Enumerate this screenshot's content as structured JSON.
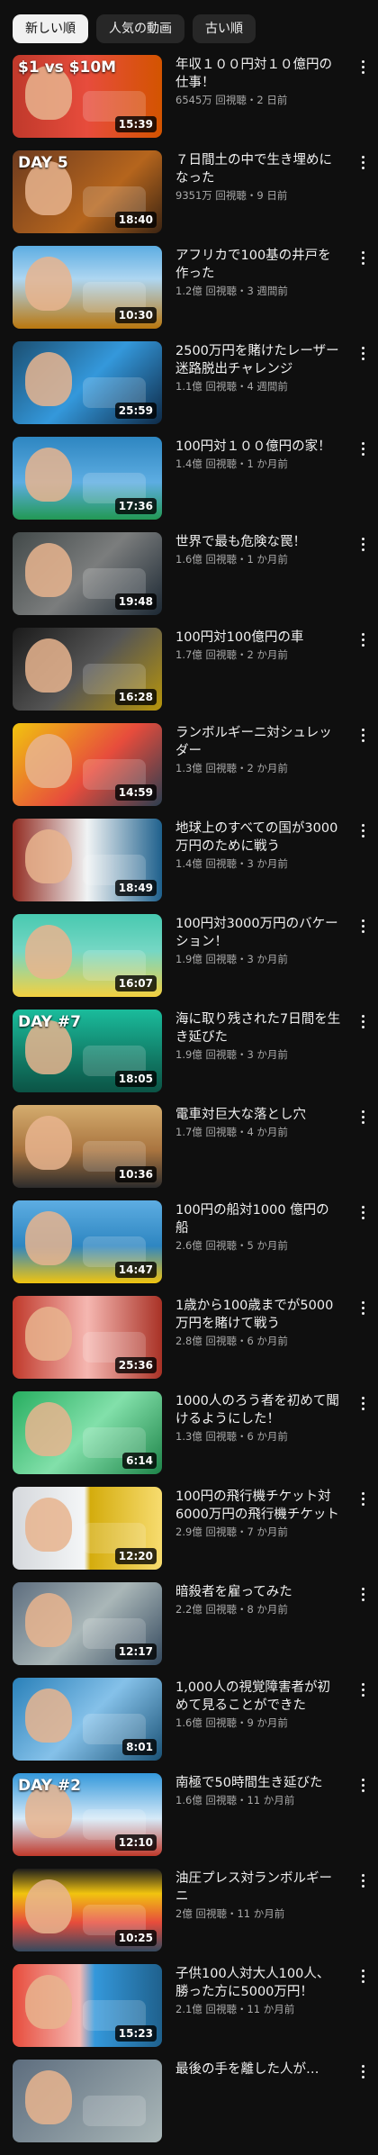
{
  "filters": [
    {
      "label": "新しい順",
      "active": true
    },
    {
      "label": "人気の動画",
      "active": false
    },
    {
      "label": "古い順",
      "active": false
    }
  ],
  "videos": [
    {
      "title": "年収１００円対１０億円の仕事！",
      "views": "6545万 回視聴",
      "age": "2 日前",
      "duration": "15:39",
      "overlay": "$1 vs $10M",
      "bg": "linear-gradient(90deg,#c0392b,#e74c3c 50%,#d35400)"
    },
    {
      "title": "７日間土の中で生き埋めになった",
      "views": "9351万 回視聴",
      "age": "9 日前",
      "duration": "18:40",
      "overlay": "DAY 5",
      "bg": "linear-gradient(135deg,#6e3b1f,#b5651d 60%,#3b2412)"
    },
    {
      "title": "アフリカで100基の井戸を作った",
      "views": "1.2億 回視聴",
      "age": "3 週間前",
      "duration": "10:30",
      "overlay": "",
      "bg": "linear-gradient(180deg,#5dade2,#aed6f1 40%,#b9770e)"
    },
    {
      "title": "2500万円を賭けたレーザー迷路脱出チャレンジ",
      "views": "1.1億 回視聴",
      "age": "4 週間前",
      "duration": "25:59",
      "overlay": "",
      "bg": "linear-gradient(135deg,#1b4f72,#3498db 50%,#0e2a47)"
    },
    {
      "title": "100円対１００億円の家！",
      "views": "1.4億 回視聴",
      "age": "1 か月前",
      "duration": "17:36",
      "overlay": "",
      "bg": "linear-gradient(180deg,#2e86c1,#5dade2 55%,#229954)"
    },
    {
      "title": "世界で最も危険な罠！",
      "views": "1.6億 回視聴",
      "age": "1 か月前",
      "duration": "19:48",
      "overlay": "",
      "bg": "linear-gradient(135deg,#424949,#7b7d7d 50%,#1c2833)"
    },
    {
      "title": "100円対100億円の車",
      "views": "1.7億 回視聴",
      "age": "2 か月前",
      "duration": "16:28",
      "overlay": "",
      "bg": "linear-gradient(135deg,#1a1a1a,#555 50%,#b7950b)"
    },
    {
      "title": "ランボルギーニ対シュレッダー",
      "views": "1.3億 回視聴",
      "age": "2 か月前",
      "duration": "14:59",
      "overlay": "",
      "bg": "linear-gradient(135deg,#f1c40f,#e74c3c 55%,#2c3e50)"
    },
    {
      "title": "地球上のすべての国が3000万円のために戦う",
      "views": "1.4億 回視聴",
      "age": "3 か月前",
      "duration": "18:49",
      "overlay": "",
      "bg": "linear-gradient(90deg,#922b21,#f0f3f4 50%,#1f618d)"
    },
    {
      "title": "100円対3000万円のバケーション！",
      "views": "1.9億 回視聴",
      "age": "3 か月前",
      "duration": "16:07",
      "overlay": "",
      "bg": "linear-gradient(180deg,#48c9b0,#76d7c4 45%,#f4d03f)"
    },
    {
      "title": "海に取り残された7日間を生き延びた",
      "views": "1.9億 回視聴",
      "age": "3 か月前",
      "duration": "18:05",
      "overlay": "DAY #7",
      "bg": "linear-gradient(180deg,#1abc9c,#117a65 60%,#0b5345)"
    },
    {
      "title": "電車対巨大な落とし穴",
      "views": "1.7億 回視聴",
      "age": "4 か月前",
      "duration": "10:36",
      "overlay": "",
      "bg": "linear-gradient(180deg,#d4ac6e,#a9743f 55%,#2c2c2c)"
    },
    {
      "title": "100円の船対1000 億円の船",
      "views": "2.6億 回視聴",
      "age": "5 か月前",
      "duration": "14:47",
      "overlay": "",
      "bg": "linear-gradient(180deg,#5dade2,#2e86c1 55%,#f1c40f)"
    },
    {
      "title": "1歳から100歳までが5000万円を賭けて戦う",
      "views": "2.8億 回視聴",
      "age": "6 か月前",
      "duration": "25:36",
      "overlay": "",
      "bg": "linear-gradient(90deg,#c0392b,#f5b7b1 50%,#a93226)"
    },
    {
      "title": "1000人のろう者を初めて聞けるようにした！",
      "views": "1.3億 回視聴",
      "age": "6 か月前",
      "duration": "6:14",
      "overlay": "",
      "bg": "linear-gradient(135deg,#27ae60,#82e0aa 50%,#1e8449)"
    },
    {
      "title": "100円の飛行機チケット対6000万円の飛行機チケット",
      "views": "2.9億 回視聴",
      "age": "7 か月前",
      "duration": "12:20",
      "overlay": "",
      "bg": "linear-gradient(90deg,#d5d8dc,#f4f6f7 48%,#d4ac0d 52%,#f7dc6f)"
    },
    {
      "title": "暗殺者を雇ってみた",
      "views": "2.2億 回視聴",
      "age": "8 か月前",
      "duration": "12:17",
      "overlay": "",
      "bg": "linear-gradient(135deg,#5d6d7e,#aab7b8 50%,#34495e)"
    },
    {
      "title": "1,000人の視覚障害者が初めて見ることができた",
      "views": "1.6億 回視聴",
      "age": "9 か月前",
      "duration": "8:01",
      "overlay": "",
      "bg": "linear-gradient(135deg,#2980b9,#85c1e9 50%,#1a5276)"
    },
    {
      "title": "南極で50時間生き延びた",
      "views": "1.6億 回視聴",
      "age": "11 か月前",
      "duration": "12:10",
      "overlay": "DAY #2",
      "bg": "linear-gradient(180deg,#3498db,#d6eaf8 55%,#c0392b)"
    },
    {
      "title": "油圧プレス対ランボルギーニ",
      "views": "2億 回視聴",
      "age": "11 か月前",
      "duration": "10:25",
      "overlay": "",
      "bg": "linear-gradient(180deg,#1c1c1c,#f1c40f 30%,#e74c3c 65%,#34495e)"
    },
    {
      "title": "子供100人対大人100人、勝った方に5000万円！",
      "views": "2.1億 回視聴",
      "age": "11 か月前",
      "duration": "15:23",
      "overlay": "",
      "bg": "linear-gradient(90deg,#e74c3c,#f5b7b1 45%,#3498db 55%,#1f618d)"
    },
    {
      "title": "最後の手を離した人が…",
      "views": "",
      "age": "",
      "duration": "",
      "overlay": "",
      "bg": "linear-gradient(135deg,#5d6d7e,#aab7b8)"
    }
  ],
  "meta_separator": "・"
}
